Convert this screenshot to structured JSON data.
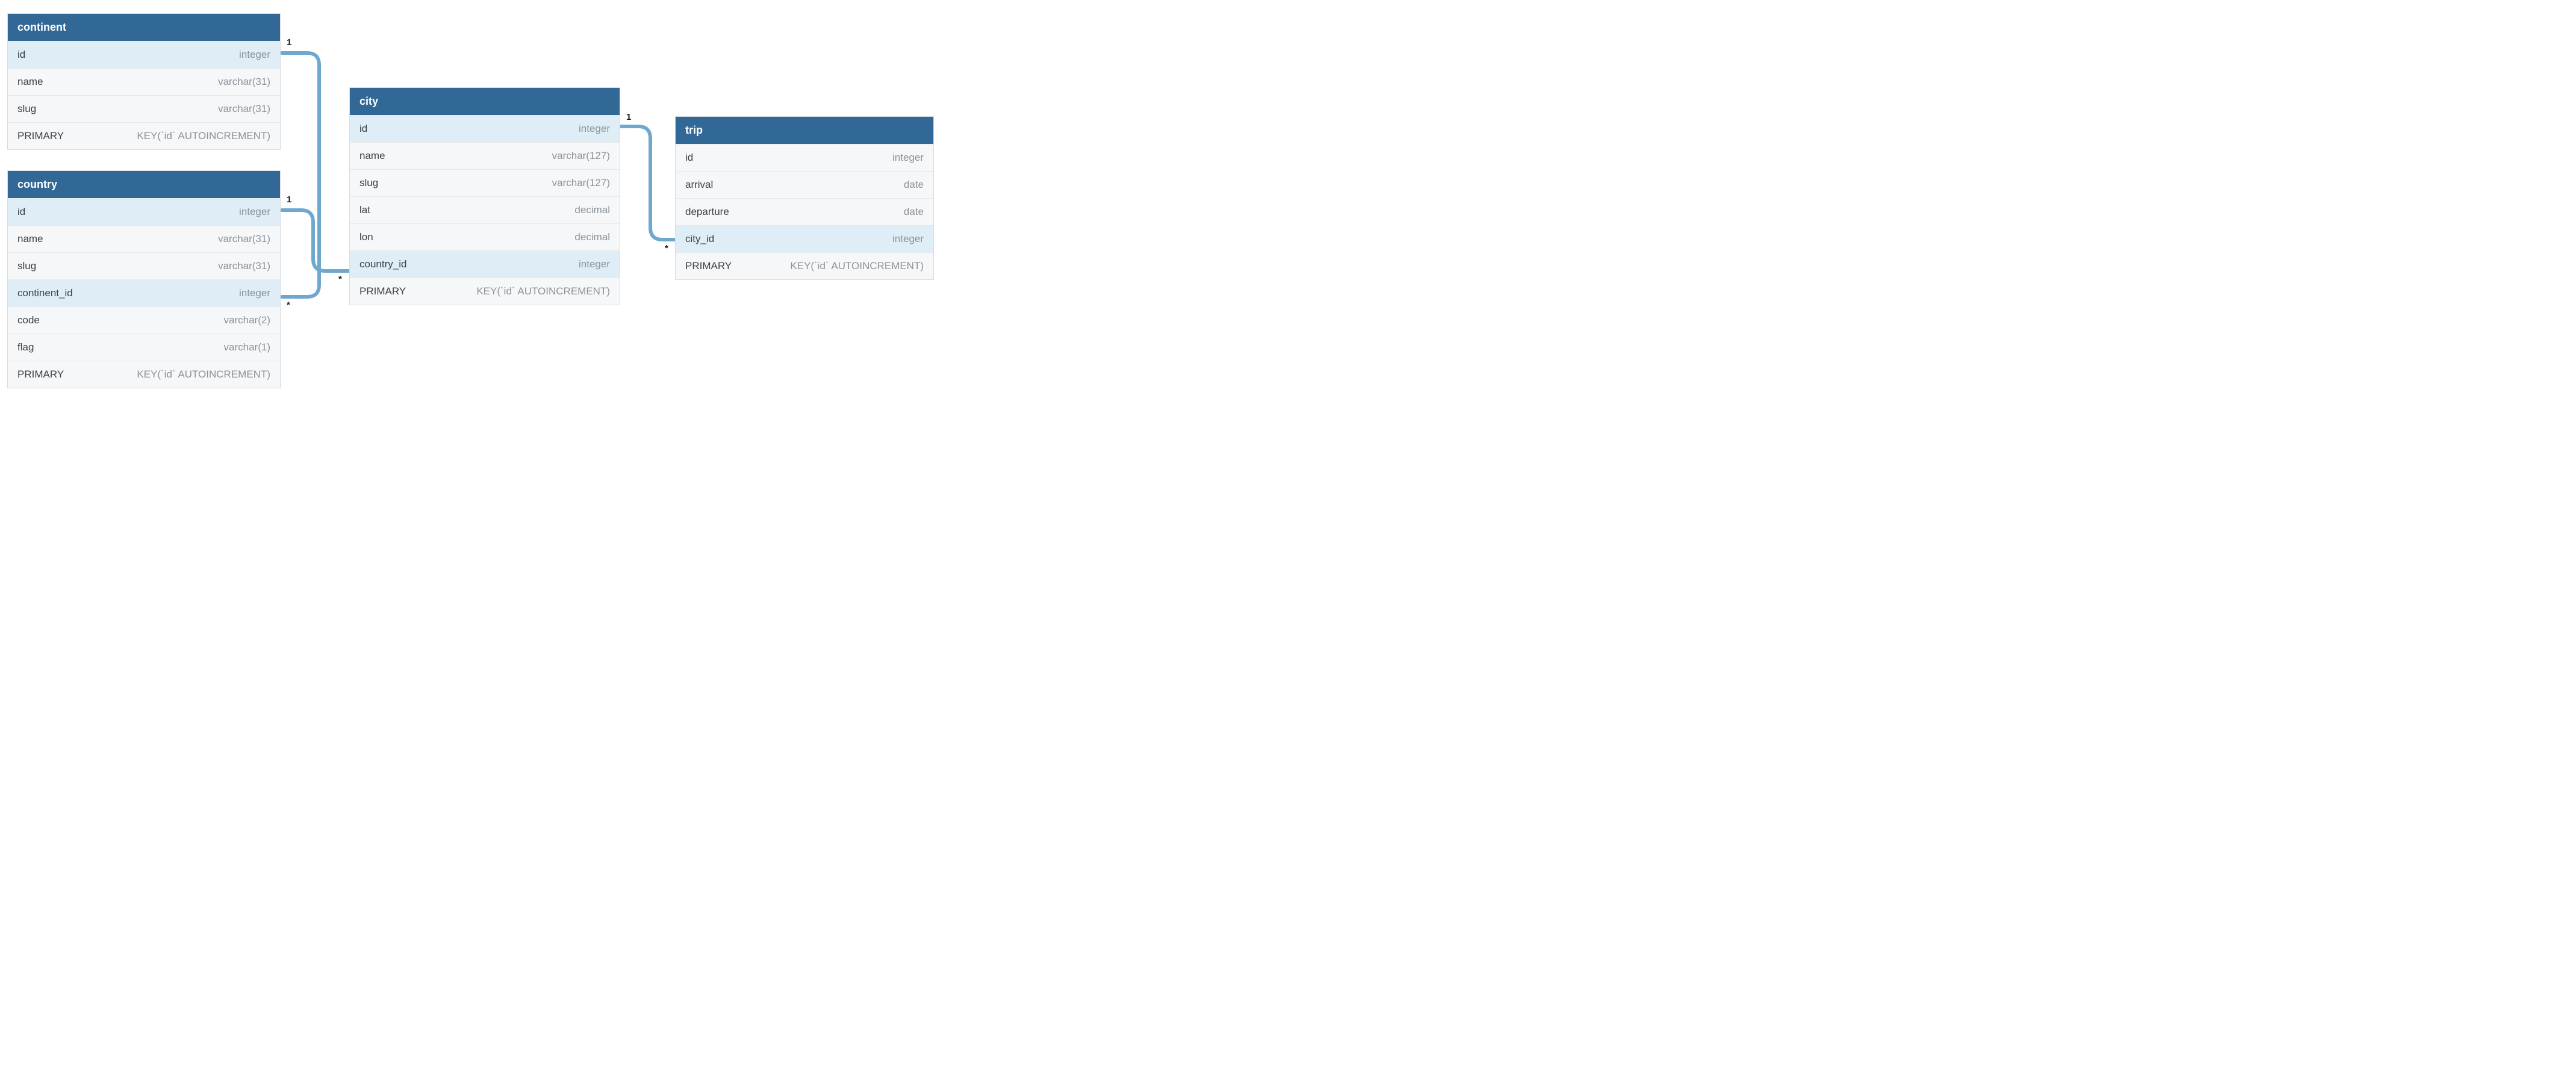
{
  "tables": {
    "continent": {
      "title": "continent",
      "rows": [
        {
          "name": "id",
          "type": "integer",
          "pk": true
        },
        {
          "name": "name",
          "type": "varchar(31)",
          "pk": false
        },
        {
          "name": "slug",
          "type": "varchar(31)",
          "pk": false
        },
        {
          "name": "PRIMARY",
          "type": "KEY(`id` AUTOINCREMENT)",
          "pk": false
        }
      ]
    },
    "country": {
      "title": "country",
      "rows": [
        {
          "name": "id",
          "type": "integer",
          "pk": true
        },
        {
          "name": "name",
          "type": "varchar(31)",
          "pk": false
        },
        {
          "name": "slug",
          "type": "varchar(31)",
          "pk": false
        },
        {
          "name": "continent_id",
          "type": "integer",
          "pk": true
        },
        {
          "name": "code",
          "type": "varchar(2)",
          "pk": false
        },
        {
          "name": "flag",
          "type": "varchar(1)",
          "pk": false
        },
        {
          "name": "PRIMARY",
          "type": "KEY(`id` AUTOINCREMENT)",
          "pk": false
        }
      ]
    },
    "city": {
      "title": "city",
      "rows": [
        {
          "name": "id",
          "type": "integer",
          "pk": true
        },
        {
          "name": "name",
          "type": "varchar(127)",
          "pk": false
        },
        {
          "name": "slug",
          "type": "varchar(127)",
          "pk": false
        },
        {
          "name": "lat",
          "type": "decimal",
          "pk": false
        },
        {
          "name": "lon",
          "type": "decimal",
          "pk": false
        },
        {
          "name": "country_id",
          "type": "integer",
          "pk": true
        },
        {
          "name": "PRIMARY",
          "type": "KEY(`id` AUTOINCREMENT)",
          "pk": false
        }
      ]
    },
    "trip": {
      "title": "trip",
      "rows": [
        {
          "name": "id",
          "type": "integer",
          "pk": false
        },
        {
          "name": "arrival",
          "type": "date",
          "pk": false
        },
        {
          "name": "departure",
          "type": "date",
          "pk": false
        },
        {
          "name": "city_id",
          "type": "integer",
          "pk": true
        },
        {
          "name": "PRIMARY",
          "type": "KEY(`id` AUTOINCREMENT)",
          "pk": false
        }
      ]
    }
  },
  "labels": {
    "one": "1",
    "many": "*"
  }
}
